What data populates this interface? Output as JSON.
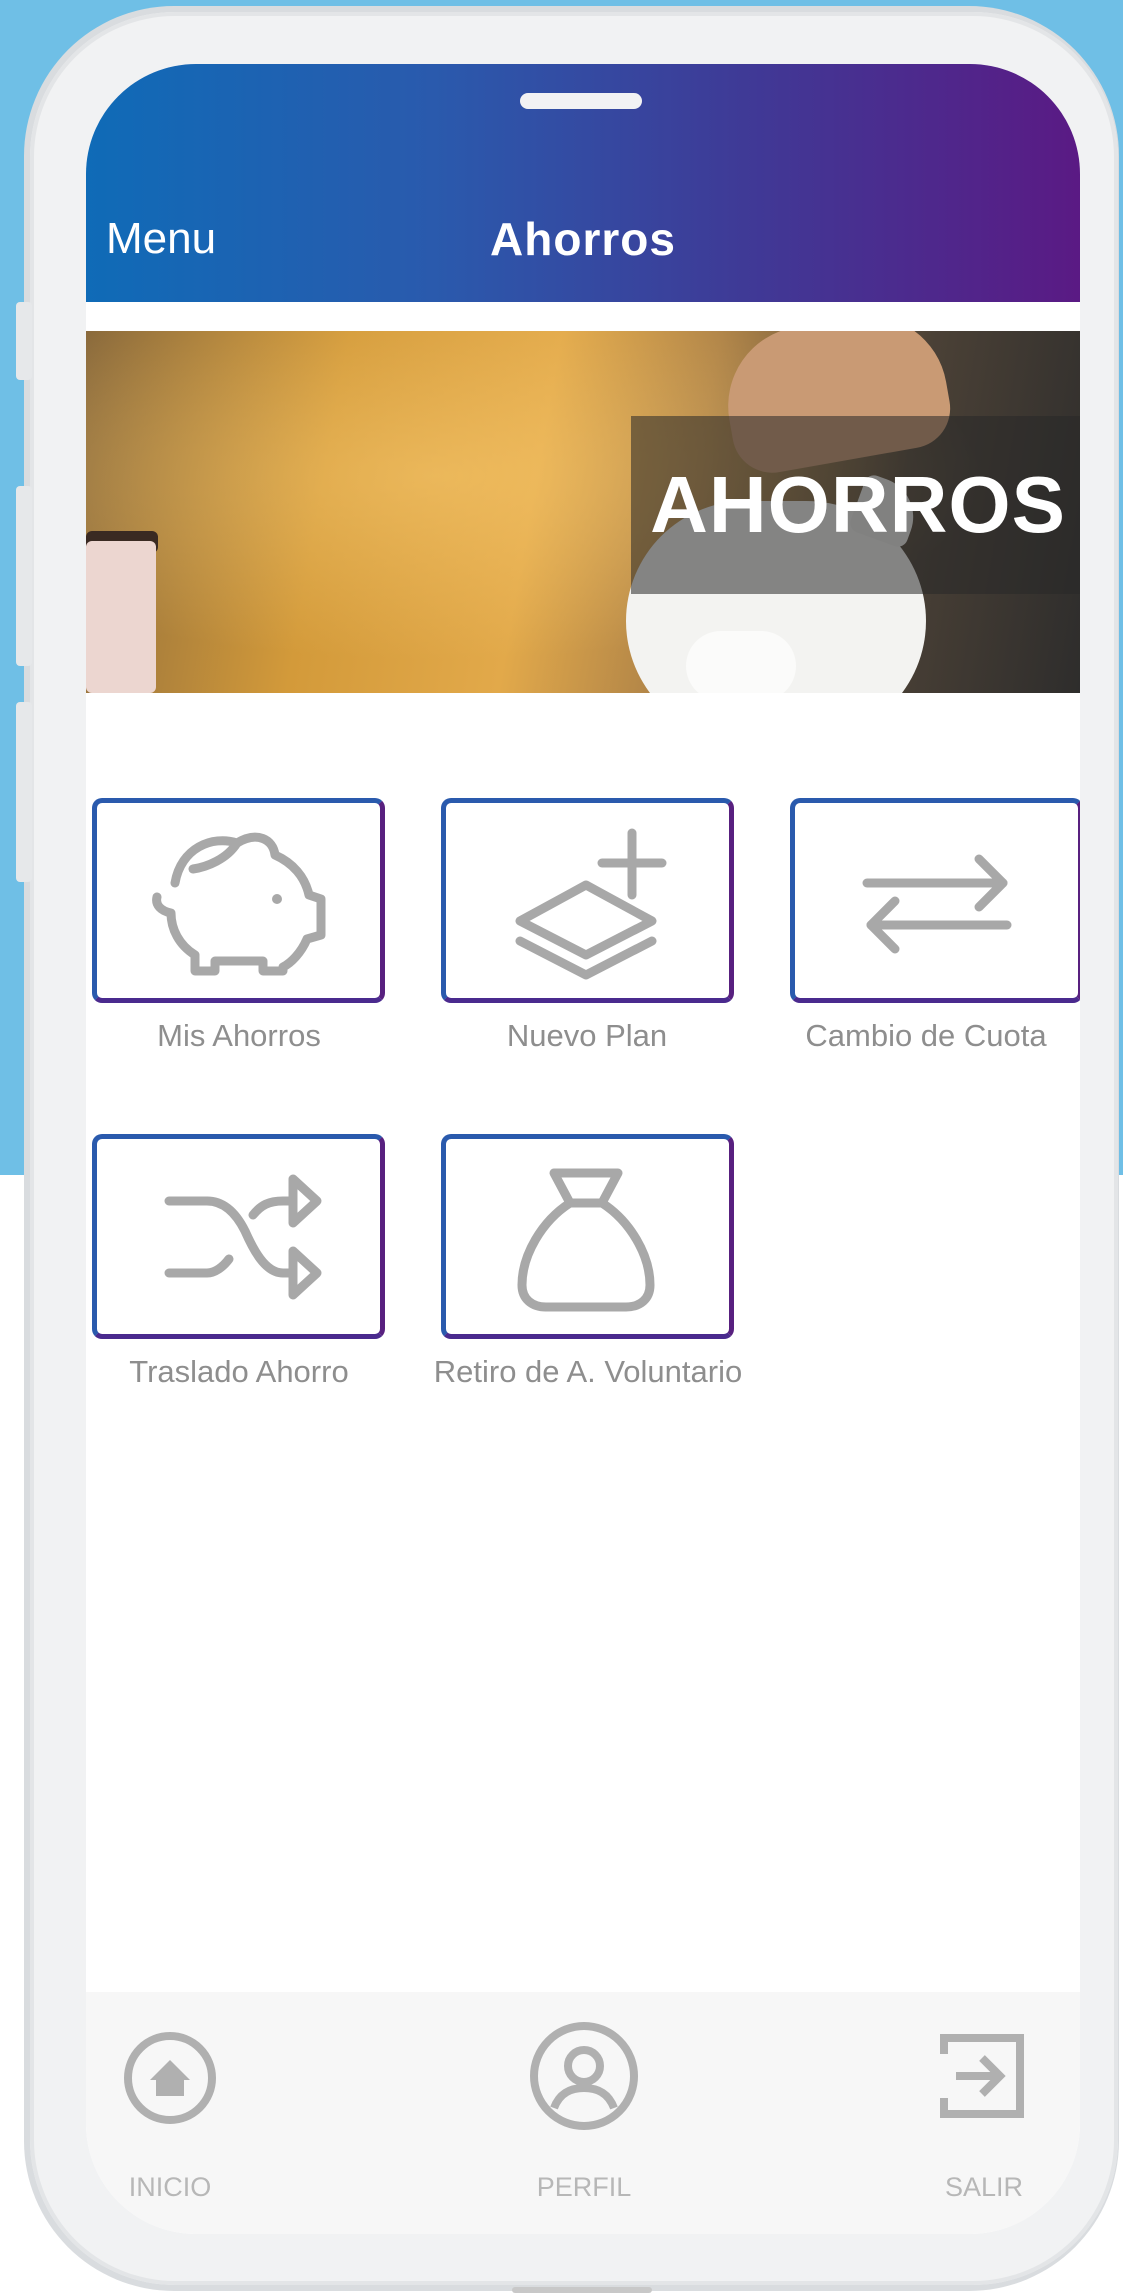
{
  "header": {
    "menu_label": "Menu",
    "title": "Ahorros"
  },
  "banner": {
    "text": "AHORROS"
  },
  "tiles": [
    {
      "label": "Mis Ahorros",
      "icon": "piggy-bank-icon"
    },
    {
      "label": "Nuevo Plan",
      "icon": "layers-plus-icon"
    },
    {
      "label": "Cambio de Cuota",
      "icon": "swap-arrows-icon"
    },
    {
      "label": "Traslado Ahorro",
      "icon": "shuffle-icon"
    },
    {
      "label": "Retiro de A. Voluntario",
      "icon": "money-bag-icon"
    }
  ],
  "bottom_nav": {
    "home_label": "INICIO",
    "profile_label": "PERFIL",
    "logout_label": "SALIR"
  },
  "colors": {
    "header_start": "#0f6bb7",
    "header_end": "#5a1a84",
    "tile_border": "#2a5aad",
    "icon_gray": "#a8a8a8",
    "label_gray": "#8e8e8e",
    "nav_gray": "#b7b7b7",
    "background_blue": "#6fbfe6"
  }
}
